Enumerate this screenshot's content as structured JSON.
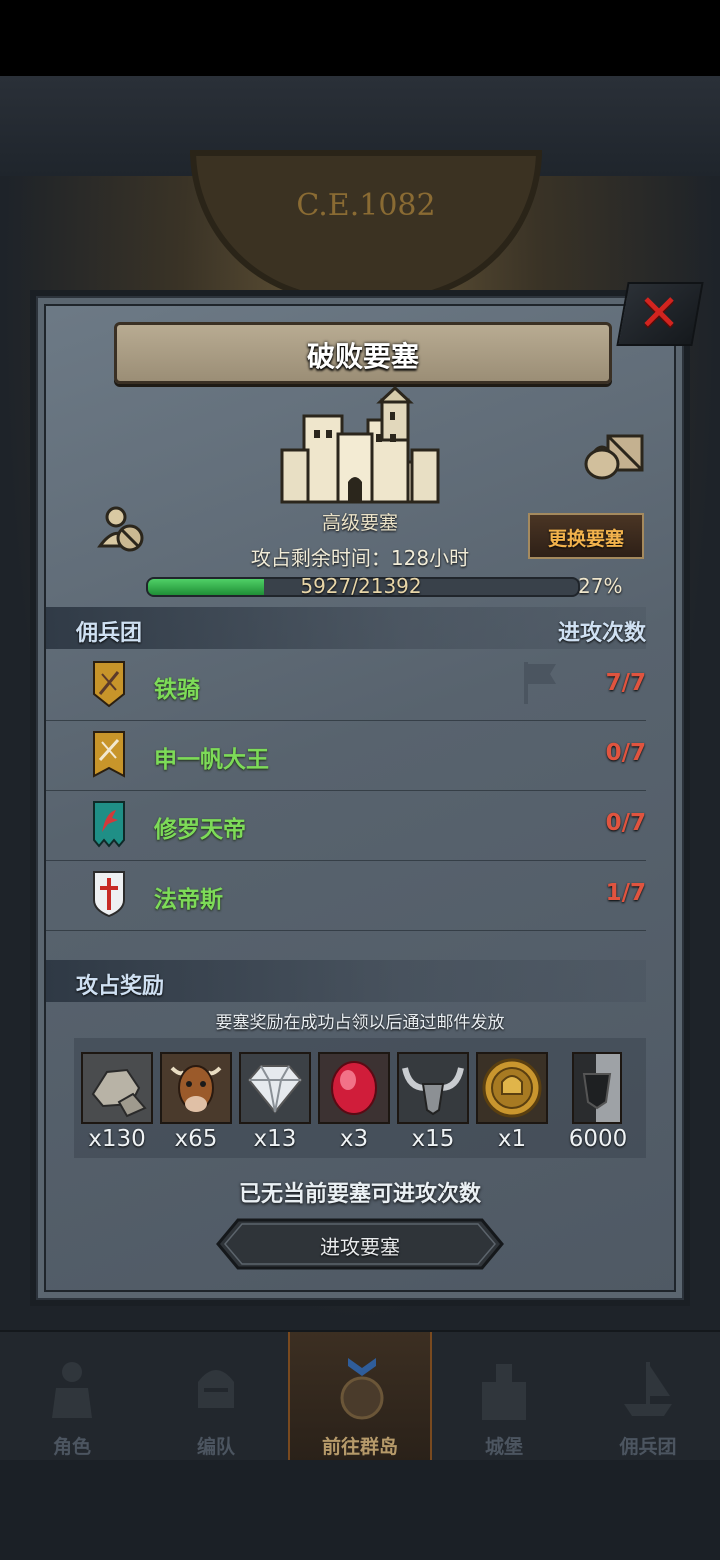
{
  "background": {
    "era": "C.E.1082"
  },
  "dialog": {
    "title": "破败要塞",
    "fortress_name": "高级要塞",
    "time_left": "攻占剩余时间：128小时",
    "change_button": "更换要塞",
    "progress": {
      "label": "5927/21392",
      "percent_label": "27%",
      "fraction": 0.27
    },
    "mercenary_section": {
      "left_header": "佣兵团",
      "right_header": "进攻次数",
      "rows": [
        {
          "name": "铁骑",
          "count": "7/7",
          "emblem": "yellow-sword-shield-icon"
        },
        {
          "name": "申一帆大王",
          "count": "0/7",
          "emblem": "yellow-sword-banner-icon"
        },
        {
          "name": "修罗天帝",
          "count": "0/7",
          "emblem": "teal-dragon-banner-icon"
        },
        {
          "name": "法帝斯",
          "count": "1/7",
          "emblem": "white-cross-shield-icon"
        }
      ]
    },
    "reward_section": {
      "header": "攻占奖励",
      "note": "要塞奖励在成功占领以后通过邮件发放",
      "items": [
        {
          "icon": "stone-icon",
          "qty": "x130"
        },
        {
          "icon": "ox-icon",
          "qty": "x65"
        },
        {
          "icon": "diamond-icon",
          "qty": "x13"
        },
        {
          "icon": "ruby-icon",
          "qty": "x3"
        },
        {
          "icon": "horns-icon",
          "qty": "x15"
        },
        {
          "icon": "gold-medal-icon",
          "qty": "x1"
        },
        {
          "icon": "banner-token-icon",
          "qty": "6000"
        }
      ]
    },
    "no_attempts": "已无当前要塞可进攻次数",
    "attack_button": "进攻要塞"
  },
  "bottom_nav": [
    {
      "label": "角色",
      "active": false
    },
    {
      "label": "编队",
      "active": false
    },
    {
      "label": "前往群岛",
      "active": true
    },
    {
      "label": "城堡",
      "active": false
    },
    {
      "label": "佣兵团",
      "active": false
    }
  ],
  "colors": {
    "accent_green": "#7ddb58",
    "count_red": "#e0543f",
    "button_gold": "#f2b24c"
  }
}
